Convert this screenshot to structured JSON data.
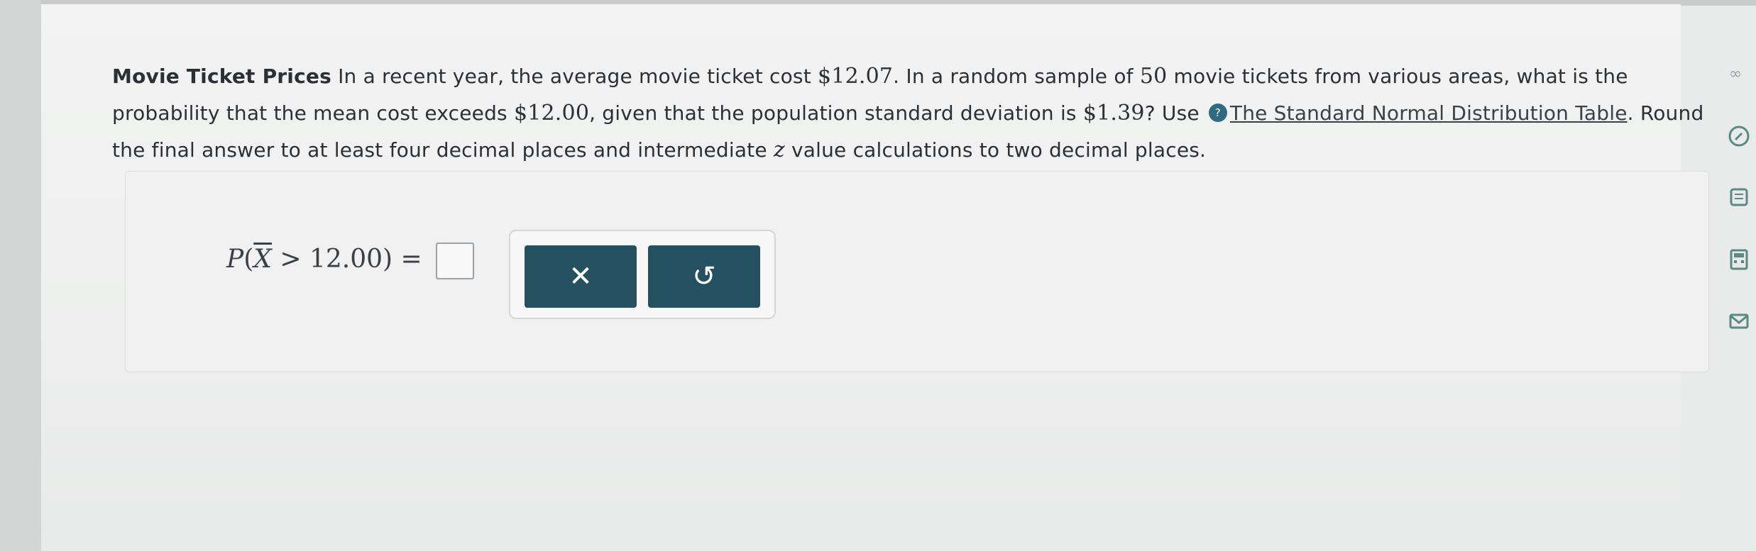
{
  "question": {
    "title": "Movie Ticket Prices",
    "part1": " In a recent year, the average movie ticket cost ",
    "avg_cost": "$12.07",
    "part2": ". In a random sample of ",
    "sample_size": "50",
    "part3": " movie tickets from various areas, what is the probability that the mean cost exceeds ",
    "threshold": "$12.00",
    "part4": ", given that the population standard deviation is ",
    "std_dev": "$1.39",
    "part5": "? Use ",
    "link_text": "The Standard Normal Distribution Table",
    "part6": ". Round the final answer to at least four decimal places and intermediate ",
    "z_symbol": "z",
    "part7": " value calculations to two decimal places."
  },
  "answer": {
    "p_label": "P",
    "open_paren": "(",
    "xbar": "X",
    "comparison": " > 12.00",
    "close_eq": ") ="
  },
  "buttons": {
    "clear_symbol": "✕",
    "undo_symbol": "↺"
  },
  "side_toolbar": {
    "icons": [
      "infinity-icon",
      "edit-icon",
      "book-icon",
      "calculator-icon",
      "mail-icon"
    ]
  }
}
